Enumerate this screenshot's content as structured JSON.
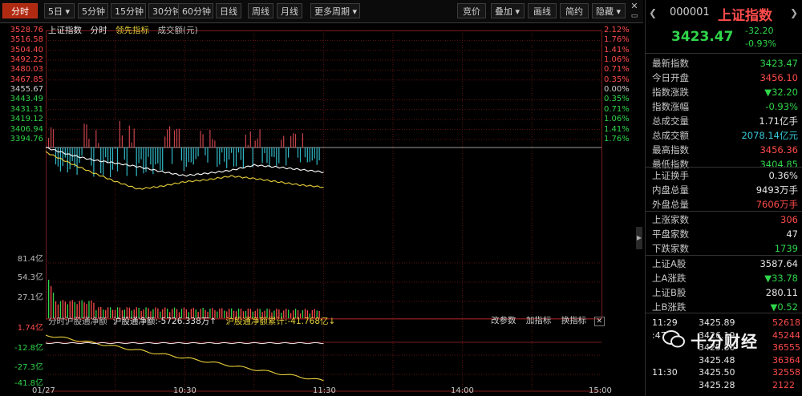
{
  "toolbar": {
    "left_buttons": [
      "分时",
      "5日",
      "5分钟",
      "15分钟",
      "30分钟",
      "60分钟",
      "日线",
      "周线",
      "月线",
      "更多周期"
    ],
    "right_buttons": [
      "竞价",
      "叠加",
      "画线",
      "简约",
      "隐藏"
    ]
  },
  "legend": {
    "index": "上证指数",
    "mode": "分时",
    "lead": "领先指标",
    "volume": "成交额(元)"
  },
  "price_axis": [
    "3528.76",
    "3516.58",
    "3504.40",
    "3492.22",
    "3480.03",
    "3467.85",
    "3455.67",
    "3443.49",
    "3431.31",
    "3419.12",
    "3406.94",
    "3394.76"
  ],
  "pct_axis": [
    "2.12%",
    "1.76%",
    "1.41%",
    "1.06%",
    "0.71%",
    "0.35%",
    "0.00%",
    "0.35%",
    "0.71%",
    "1.06%",
    "1.41%",
    "1.76%"
  ],
  "volume_axis": [
    "81.4亿",
    "54.3亿",
    "27.1亿"
  ],
  "north_axis": [
    "1.74亿",
    "-12.8亿",
    "-27.3亿",
    "-41.8亿"
  ],
  "north_bar": {
    "title": "分时沪股通净额",
    "net_label": "沪股通净额:",
    "net_value": "-5726.338万",
    "cum_label": "沪股通净额累计:",
    "cum_value": "-41.768亿",
    "buttons": [
      "改参数",
      "加指标",
      "换指标"
    ]
  },
  "time_axis": [
    "01/27",
    "10:30",
    "11:30",
    "14:00",
    "15:00"
  ],
  "colors": {
    "up": "#ff4b4b",
    "down": "#2fd64a",
    "price_line": "#ffffff",
    "avg_line": "#e8d03a",
    "lead_bar_up": "#c8434b",
    "lead_bar_down": "#31b8c6"
  },
  "side": {
    "code": "000001",
    "name": "上证指数",
    "price": "3423.47",
    "change": "-32.20",
    "change_pct": "-0.93%",
    "stats": [
      {
        "k": "最新指数",
        "v": "3423.47",
        "c": "green"
      },
      {
        "k": "今日开盘",
        "v": "3456.10",
        "c": "red"
      },
      {
        "k": "指数涨跌",
        "v": "▼32.20",
        "c": "green"
      },
      {
        "k": "指数涨幅",
        "v": "-0.93%",
        "c": "green"
      },
      {
        "k": "总成交量",
        "v": "1.71亿手",
        "c": "white"
      },
      {
        "k": "总成交额",
        "v": "2078.14亿元",
        "c": "cyan"
      },
      {
        "k": "最高指数",
        "v": "3456.36",
        "c": "red"
      },
      {
        "k": "最低指数",
        "v": "3404.85",
        "c": "green"
      }
    ],
    "stats2": [
      {
        "k": "上证换手",
        "v": "0.36%",
        "c": "white"
      },
      {
        "k": "内盘总量",
        "v": "9493万手",
        "c": "white"
      },
      {
        "k": "外盘总量",
        "v": "7606万手",
        "c": "red"
      }
    ],
    "stats3": [
      {
        "k": "上涨家数",
        "v": "306",
        "c": "red"
      },
      {
        "k": "平盘家数",
        "v": "47",
        "c": "white"
      },
      {
        "k": "下跌家数",
        "v": "1739",
        "c": "green"
      }
    ],
    "stats4": [
      {
        "k": "上证A股",
        "v": "3587.64",
        "c": "white"
      },
      {
        "k": "上A涨跌",
        "v": "▼33.78",
        "c": "green"
      },
      {
        "k": "上证B股",
        "v": "280.11",
        "c": "white"
      },
      {
        "k": "上B涨跌",
        "v": "▼0.52",
        "c": "green"
      }
    ],
    "ticks": [
      {
        "t": "11:29",
        "p": "3425.89",
        "v": "52618"
      },
      {
        "t": ":47",
        "p": "3426.19",
        "v": "45244"
      },
      {
        "t": "",
        "p": "3425.80",
        "v": "36555"
      },
      {
        "t": "",
        "p": "3425.48",
        "v": "36364"
      },
      {
        "t": "11:30",
        "p": "3425.50",
        "v": "32558"
      },
      {
        "t": "",
        "p": "3425.28",
        "v": "2122"
      }
    ],
    "watermark": "十分财经"
  },
  "chart_data": {
    "type": "line",
    "x": [
      "09:30",
      "09:40",
      "09:50",
      "10:00",
      "10:10",
      "10:20",
      "10:30",
      "10:40",
      "10:50",
      "11:00",
      "11:10",
      "11:20",
      "11:30"
    ],
    "series": [
      {
        "values": [
          3455.7,
          3447.0,
          3440.5,
          3436.5,
          3432.0,
          3426.0,
          3421.0,
          3424.0,
          3427.5,
          3434.0,
          3431.5,
          3428.5,
          3425.3
        ]
      },
      {
        "values": [
          3450.0,
          3437.0,
          3425.0,
          3414.0,
          3404.5,
          3408.0,
          3413.5,
          3416.0,
          3420.5,
          3417.5,
          3413.5,
          3409.5,
          3407.0
        ]
      }
    ],
    "ylim": [
      3394.76,
      3528.76
    ]
  }
}
